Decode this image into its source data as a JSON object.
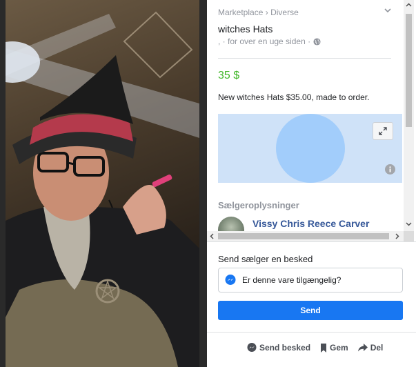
{
  "breadcrumb": {
    "root": "Marketplace",
    "separator": "›",
    "category": "Diverse"
  },
  "listing": {
    "title": "witches Hats",
    "meta": ", · for over en uge siden ·",
    "price": "35 $",
    "description": "New witches Hats $35.00, made to order."
  },
  "seller": {
    "heading": "Sælgeroplysninger",
    "name": "Vissy Chris Reece Carver"
  },
  "message": {
    "label": "Send sælger en besked",
    "input_value": "Er denne vare tilgængelig?",
    "send_label": "Send"
  },
  "actions": {
    "send_message": "Send besked",
    "save": "Gem",
    "share": "Del"
  },
  "colors": {
    "price": "#42b72a",
    "send_button": "#1877f2",
    "seller_name": "#365899",
    "map_bg": "#cfe2f8",
    "map_circle": "#a2cdfb"
  },
  "icons": [
    "chevron-down-icon",
    "globe-icon",
    "expand-icon",
    "info-icon",
    "messenger-icon",
    "bookmark-icon",
    "share-icon"
  ]
}
